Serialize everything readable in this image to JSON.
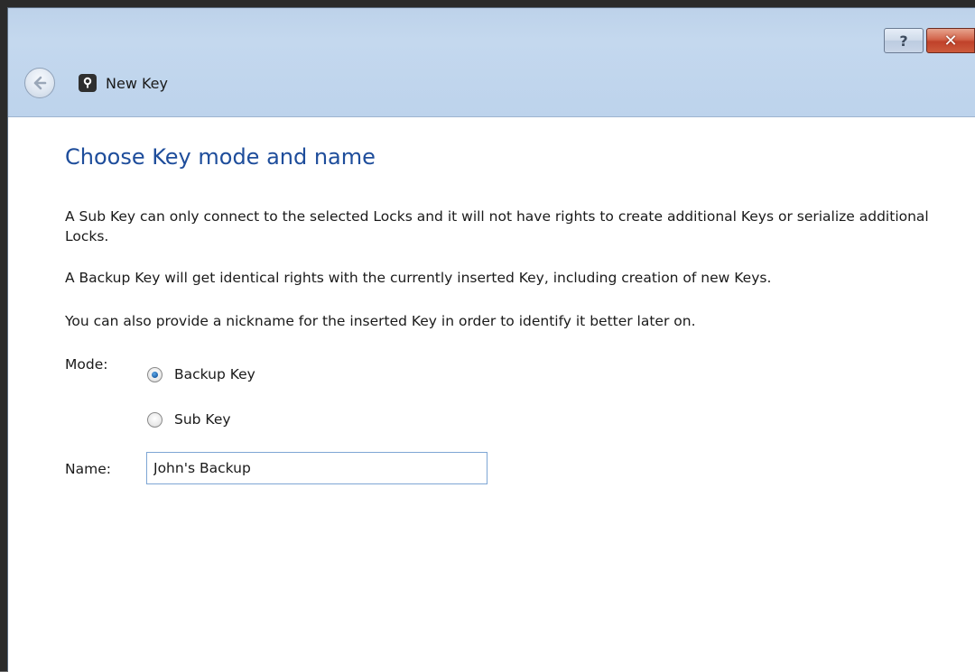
{
  "window": {
    "help_button_label": "?",
    "close_button_label": "✕"
  },
  "nav": {
    "back_icon": "back-arrow-icon",
    "key_icon": "key-icon",
    "title": "New Key"
  },
  "page": {
    "heading": "Choose Key mode and name",
    "paragraphs": [
      "A Sub Key can only connect to the selected Locks and it will not have rights to create additional Keys or serialize additional Locks.",
      "A Backup Key will get identical rights with the currently inserted Key, including creation of new Keys.",
      "You can also provide a nickname for the inserted Key in order to identify it better later on."
    ],
    "mode_label": "Mode:",
    "mode_options": [
      {
        "label": "Backup Key",
        "selected": true
      },
      {
        "label": "Sub Key",
        "selected": false
      }
    ],
    "name_label": "Name:",
    "name_value": "John's Backup"
  },
  "colors": {
    "heading": "#1e4d9b",
    "titlebar": "#c4d8ee",
    "close_button": "#c0412a",
    "radio_selected": "#1b5fa8"
  }
}
